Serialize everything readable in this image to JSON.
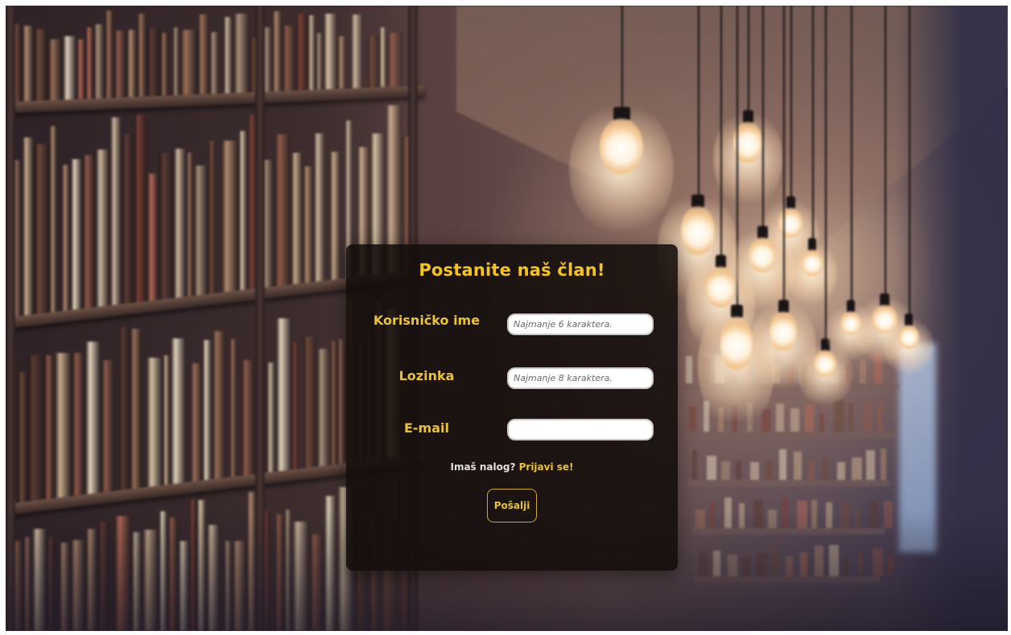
{
  "form": {
    "title": "Postanite naš član!",
    "fields": [
      {
        "label": "Korisničko ime",
        "placeholder": "Najmanje 6 karaktera.",
        "value": ""
      },
      {
        "label": "Lozinka",
        "placeholder": "Najmanje 8 karaktera.",
        "value": ""
      },
      {
        "label": "E-mail",
        "placeholder": "",
        "value": ""
      }
    ],
    "login_prompt": "Imaš nalog?",
    "login_link": "Prijavi se!",
    "submit_label": "Pošalji"
  },
  "colors": {
    "accent": "#f4c51e",
    "card_bg": "#120d0a",
    "input_bg": "#ffffff"
  }
}
